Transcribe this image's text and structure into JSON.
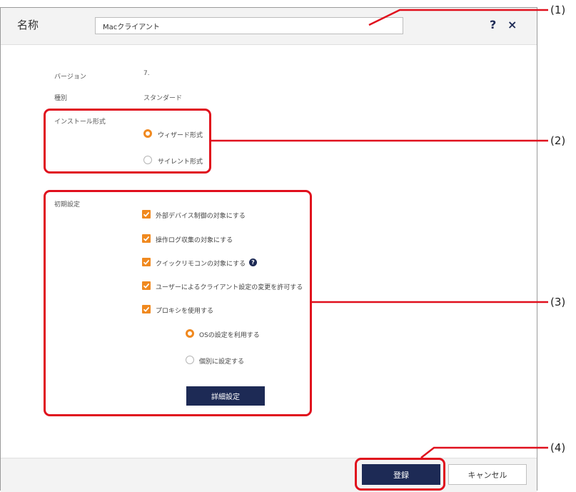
{
  "header": {
    "title": "名称",
    "name_value": "Macクライアント",
    "help_glyph": "?",
    "close_glyph": "×"
  },
  "info": {
    "version_label": "バージョン",
    "version_value": "7.",
    "type_label": "種別",
    "type_value": "スタンダード"
  },
  "install": {
    "label": "インストール形式",
    "options": [
      {
        "label": "ウィザード形式",
        "selected": true
      },
      {
        "label": "サイレント形式",
        "selected": false
      }
    ]
  },
  "initial": {
    "label": "初期設定",
    "checks": [
      {
        "label": "外部デバイス制御の対象にする",
        "checked": true
      },
      {
        "label": "操作ログ収集の対象にする",
        "checked": true
      },
      {
        "label": "クイックリモコンの対象にする",
        "checked": true
      },
      {
        "label": "ユーザーによるクライアント設定の変更を許可する",
        "checked": true
      },
      {
        "label": "プロキシを使用する",
        "checked": true
      }
    ],
    "quick_help_glyph": "?",
    "proxy_options": [
      {
        "label": "OSの設定を利用する",
        "selected": true
      },
      {
        "label": "個別に設定する",
        "selected": false
      }
    ],
    "detail_button": "詳細設定"
  },
  "footer": {
    "register_button": "登録",
    "cancel_button": "キャンセル"
  },
  "callouts": [
    "(1)",
    "(2)",
    "(3)",
    "(4)"
  ],
  "colors": {
    "accent": "#f0891f",
    "primary": "#1d2a55",
    "highlight": "#e0101d"
  }
}
